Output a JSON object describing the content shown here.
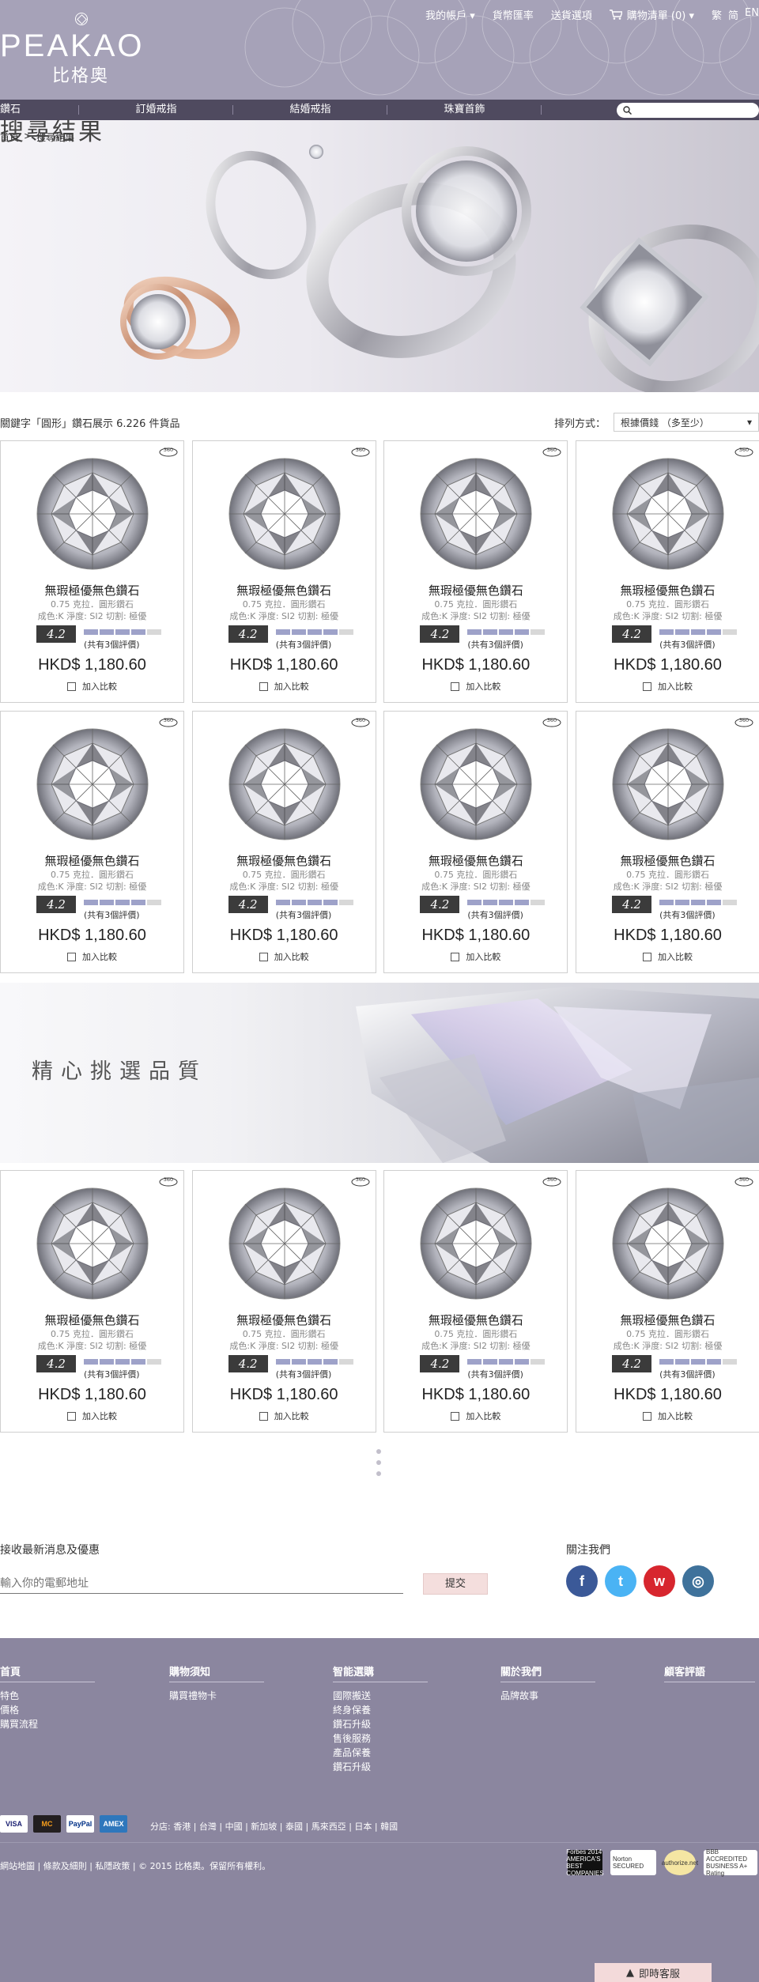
{
  "header": {
    "brand": "PEAKAO",
    "brand_cn": "比格奧",
    "account": "我的帳戶 ▾",
    "currency": "貨幣匯率",
    "shipping": "送貨選項",
    "cart": "購物清單 (0) ▾",
    "lang_tc": "繁",
    "lang_sc": "简",
    "lang_en": "EN"
  },
  "nav": {
    "items": [
      "鑽石",
      "訂婚戒指",
      "結婚戒指",
      "珠寶首飾"
    ],
    "search_placeholder": ""
  },
  "breadcrumb": {
    "home": "首頁",
    "sep": ">",
    "current": "搜尋結果"
  },
  "hero": {
    "title": "搜尋結果"
  },
  "results": {
    "summary": "關鍵字「圓形」鑽石展示 6.226 件貨品",
    "sort_label": "排列方式：",
    "sort_value": "根據價錢 （多至少）"
  },
  "product": {
    "name": "無瑕極優無色鑽石",
    "spec1": "0.75 克拉．圓形鑽石",
    "spec2": "成色:K   淨度: SI2   切割: 極優",
    "score": "4.2",
    "rating_fraction": 0.8,
    "reviews": "(共有3個評價)",
    "price": "HKD$ 1,180.60",
    "compare": "加入比較"
  },
  "banner": {
    "title": "精心挑選品質"
  },
  "newsletter": {
    "title": "接收最新消息及優惠",
    "placeholder": "輸入你的電郵地址",
    "submit": "提交",
    "follow": "關注我們"
  },
  "footer": {
    "col1": {
      "title": "首頁",
      "links": [
        "特色",
        "價格",
        "購買流程"
      ]
    },
    "col2": {
      "title": "購物須知",
      "links": [
        "購買禮物卡"
      ]
    },
    "col3": {
      "title": "智能選購",
      "links": [
        "國際搬送",
        "終身保養",
        "鑽石升級",
        "售後服務",
        "產品保養",
        "鑽石升級"
      ]
    },
    "col4": {
      "title": "關於我們",
      "links": [
        "品牌故事"
      ]
    },
    "col5": {
      "title": "顧客評語",
      "links": []
    },
    "payments": [
      "VISA",
      "MC",
      "PayPal",
      "AMEX"
    ],
    "branches": "分店: 香港 | 台灣 | 中國 | 新加坡 | 泰國 | 馬來西亞 | 日本 | 韓國",
    "copyright": "網站地圖 | 條款及細則  | 私隱政策 | © 2015 比格奧。保留所有權利。",
    "certs": [
      "Forbes 2014 AMERICA'S BEST COMPANIES",
      "Norton SECURED",
      "authorize.net",
      "BBB ACCREDITED BUSINESS A+ Rating"
    ]
  },
  "livechat": "即時客服",
  "colors": {
    "accent": "#4f4a5f",
    "header": "#a6a2b8",
    "footer": "#8b869f",
    "rating": "#9ea2c9"
  }
}
